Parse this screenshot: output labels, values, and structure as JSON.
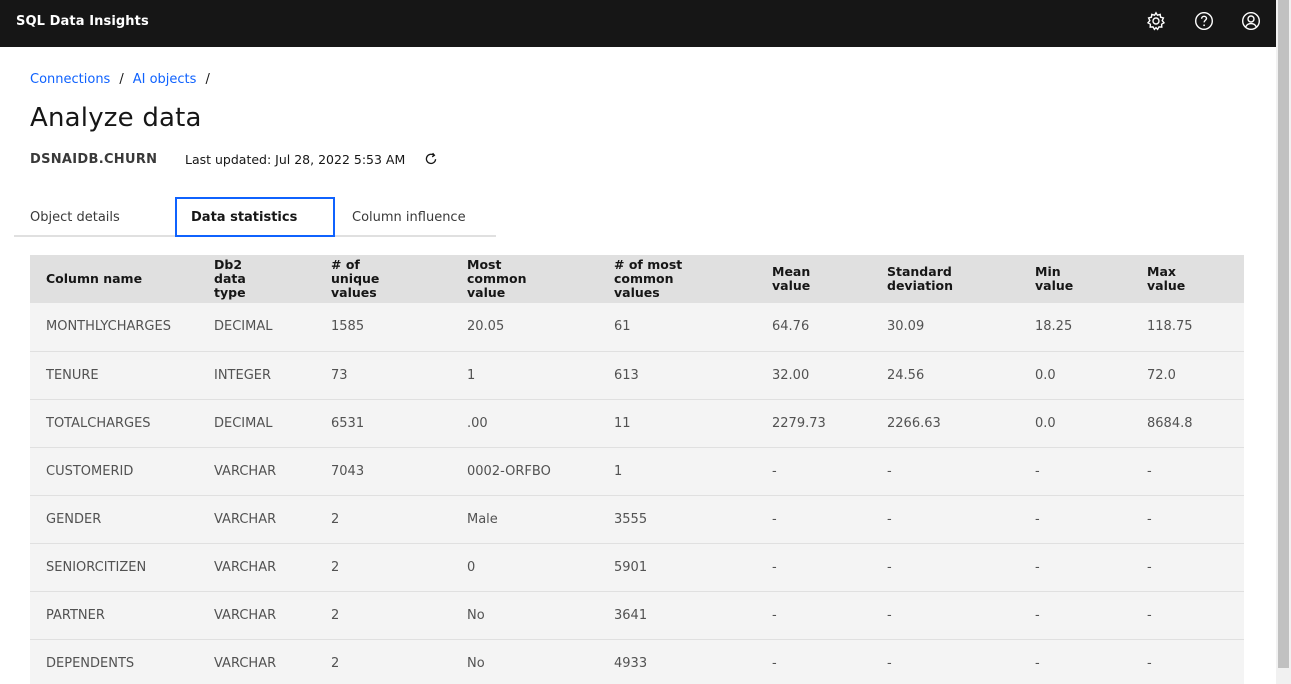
{
  "header": {
    "app_title": "SQL Data Insights",
    "icons": [
      "gear-icon",
      "help-icon",
      "user-avatar-icon"
    ]
  },
  "breadcrumb": {
    "items": [
      "Connections",
      "AI objects"
    ],
    "separator": "/"
  },
  "page": {
    "title": "Analyze data",
    "object_name": "DSNAIDB.CHURN",
    "last_updated": "Last updated: Jul 28, 2022 5:53 AM"
  },
  "tabs": [
    {
      "label": "Object details",
      "active": false
    },
    {
      "label": "Data statistics",
      "active": true
    },
    {
      "label": "Column influence",
      "active": false
    }
  ],
  "table": {
    "headers": [
      [
        "Column name"
      ],
      [
        "Db2",
        "data",
        "type"
      ],
      [
        "# of",
        "unique",
        "values"
      ],
      [
        "Most",
        "common",
        "value"
      ],
      [
        "# of most",
        "common",
        "values"
      ],
      [
        "Mean",
        "value"
      ],
      [
        "Standard",
        "deviation"
      ],
      [
        "Min",
        "value"
      ],
      [
        "Max",
        "value"
      ]
    ],
    "rows": [
      [
        "MONTHLYCHARGES",
        "DECIMAL",
        "1585",
        "20.05",
        "61",
        "64.76",
        "30.09",
        "18.25",
        "118.75"
      ],
      [
        "TENURE",
        "INTEGER",
        "73",
        "1",
        "613",
        "32.00",
        "24.56",
        "0.0",
        "72.0"
      ],
      [
        "TOTALCHARGES",
        "DECIMAL",
        "6531",
        ".00",
        "11",
        "2279.73",
        "2266.63",
        "0.0",
        "8684.8"
      ],
      [
        "CUSTOMERID",
        "VARCHAR",
        "7043",
        "0002-ORFBO",
        "1",
        "-",
        "-",
        "-",
        "-"
      ],
      [
        "GENDER",
        "VARCHAR",
        "2",
        "Male",
        "3555",
        "-",
        "-",
        "-",
        "-"
      ],
      [
        "SENIORCITIZEN",
        "VARCHAR",
        "2",
        "0",
        "5901",
        "-",
        "-",
        "-",
        "-"
      ],
      [
        "PARTNER",
        "VARCHAR",
        "2",
        "No",
        "3641",
        "-",
        "-",
        "-",
        "-"
      ],
      [
        "DEPENDENTS",
        "VARCHAR",
        "2",
        "No",
        "4933",
        "-",
        "-",
        "-",
        "-"
      ]
    ]
  },
  "colors": {
    "topbar": "#161616",
    "link": "#0f62fe",
    "active_tab_border": "#0f62fe",
    "table_header_bg": "#e0e0e0",
    "table_row_bg": "#f4f4f4"
  }
}
